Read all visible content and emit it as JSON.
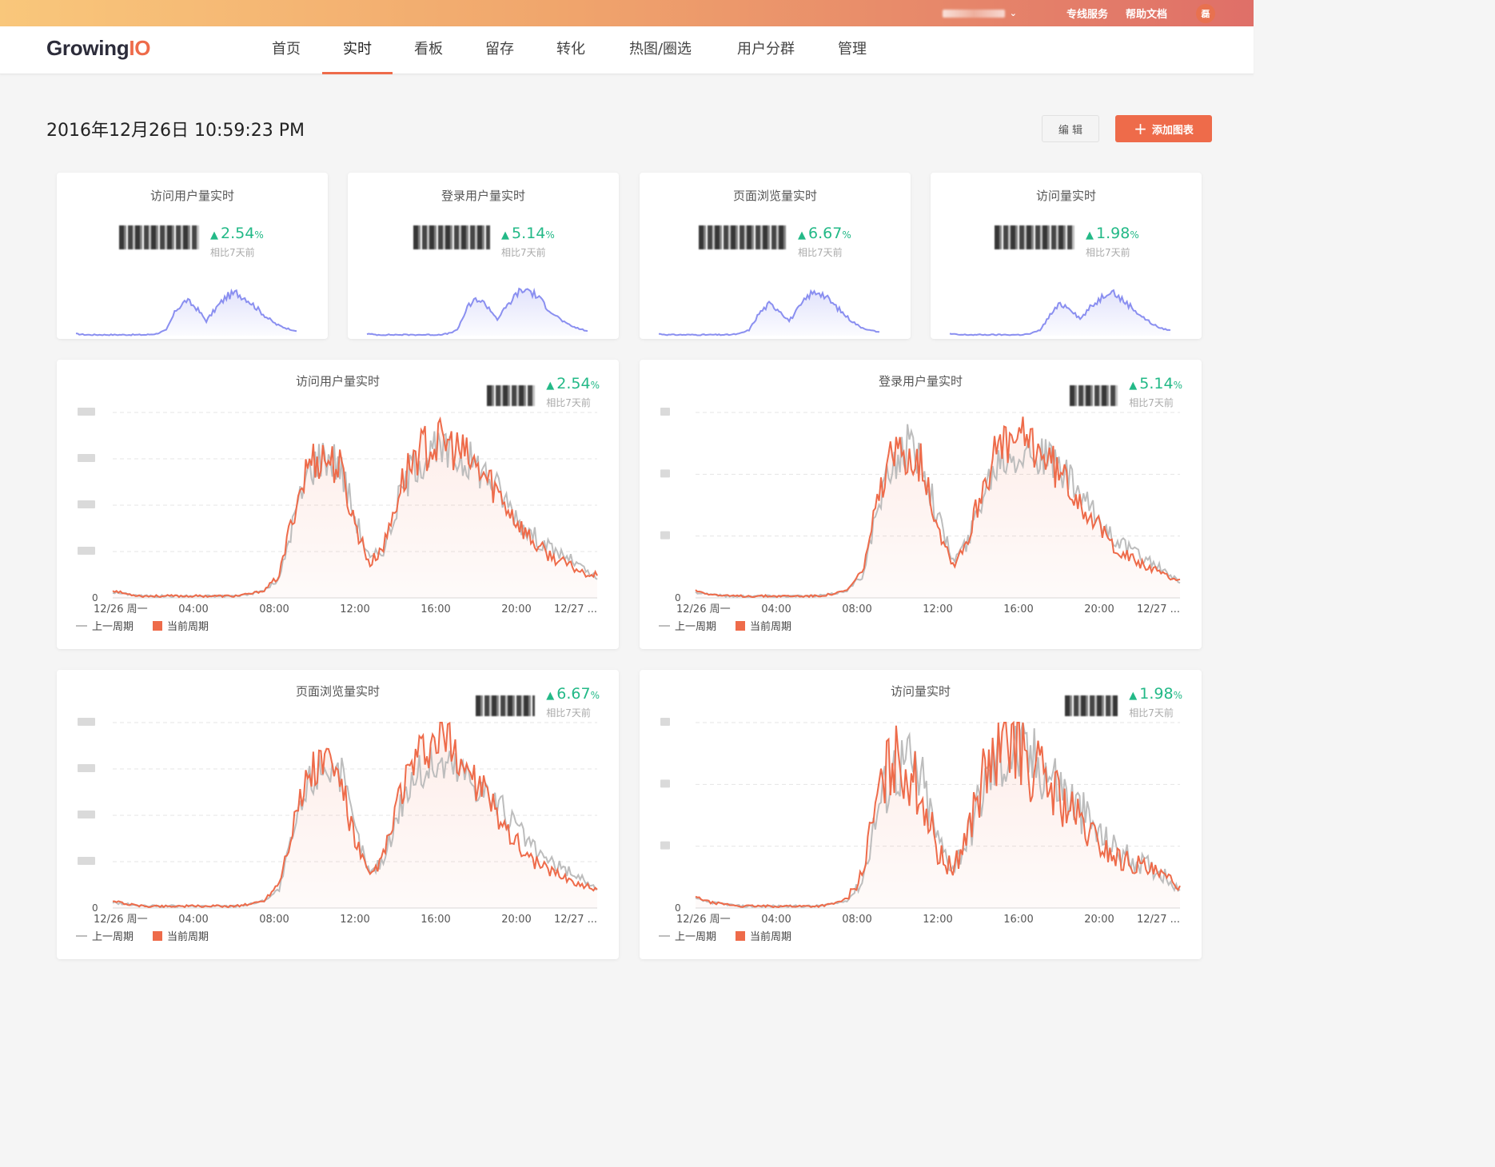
{
  "topbar": {
    "user_chevron": "⌄",
    "links": [
      "专线服务",
      "帮助文档"
    ],
    "avatar_text": "磊"
  },
  "nav": {
    "logo_main": "Growing",
    "logo_io": "IO",
    "tabs": [
      "首页",
      "实时",
      "看板",
      "留存",
      "转化",
      "热图/圈选",
      "用户分群",
      "管理"
    ],
    "active_tab": "实时"
  },
  "header": {
    "datetime": "2016年12月26日 10:59:23 PM",
    "edit_label": "编 辑",
    "add_label": "添加图表"
  },
  "kpis": [
    {
      "title": "访问用户量实时",
      "value": "",
      "delta": "2.54",
      "compare": "相比7天前"
    },
    {
      "title": "登录用户量实时",
      "value": "",
      "delta": "5.14",
      "compare": "相比7天前"
    },
    {
      "title": "页面浏览量实时",
      "value": "",
      "delta": "6.67",
      "compare": "相比7天前"
    },
    {
      "title": "访问量实时",
      "value": "",
      "delta": "1.98",
      "compare": "相比7天前"
    }
  ],
  "chart_cards": [
    {
      "title": "访问用户量实时",
      "delta": "2.54",
      "compare": "相比7天前"
    },
    {
      "title": "登录用户量实时",
      "delta": "5.14",
      "compare": "相比7天前"
    },
    {
      "title": "页面浏览量实时",
      "delta": "6.67",
      "compare": "相比7天前"
    },
    {
      "title": "访问量实时",
      "delta": "1.98",
      "compare": "相比7天前"
    }
  ],
  "legend": {
    "prev": "上一周期",
    "current": "当前周期"
  },
  "colors": {
    "accent": "#ee6b4a",
    "positive": "#23b987",
    "kpi_line": "#8a8ff0",
    "prev_line": "#bdbdbd"
  },
  "chart_data": [
    {
      "type": "area",
      "title": "访问用户量实时",
      "x": [
        "12/26 周一",
        "04:00",
        "08:00",
        "12:00",
        "16:00",
        "20:00",
        "12/27 ..."
      ],
      "y_tick_labels_masked": true,
      "series": [
        {
          "name": "当前周期",
          "values": [
            4,
            2,
            1,
            1,
            1,
            1,
            1,
            1,
            1,
            2,
            4,
            12,
            48,
            74,
            76,
            70,
            40,
            18,
            30,
            60,
            78,
            82,
            84,
            78,
            70,
            62,
            50,
            38,
            28,
            22,
            18,
            14,
            12
          ]
        },
        {
          "name": "上一周期",
          "values": [
            3,
            2,
            1,
            1,
            1,
            1,
            1,
            1,
            1,
            2,
            4,
            10,
            44,
            70,
            78,
            72,
            44,
            20,
            28,
            56,
            74,
            78,
            78,
            76,
            72,
            64,
            52,
            40,
            32,
            26,
            22,
            16,
            10
          ]
        }
      ]
    },
    {
      "type": "area",
      "title": "登录用户量实时",
      "x": [
        "12/26 周一",
        "04:00",
        "08:00",
        "12:00",
        "16:00",
        "20:00",
        "12/27 ..."
      ],
      "y_tick_labels_masked": true,
      "series": [
        {
          "name": "当前周期",
          "values": [
            4,
            2,
            1,
            1,
            1,
            1,
            1,
            1,
            1,
            2,
            4,
            14,
            50,
            76,
            80,
            72,
            40,
            18,
            32,
            62,
            80,
            84,
            86,
            78,
            68,
            58,
            46,
            34,
            26,
            20,
            16,
            12,
            10
          ]
        },
        {
          "name": "上一周期",
          "values": [
            3,
            2,
            1,
            1,
            1,
            1,
            1,
            1,
            1,
            2,
            4,
            12,
            46,
            72,
            82,
            74,
            44,
            20,
            30,
            58,
            76,
            80,
            80,
            76,
            70,
            60,
            48,
            38,
            30,
            24,
            20,
            14,
            8
          ]
        }
      ]
    },
    {
      "type": "area",
      "title": "页面浏览量实时",
      "x": [
        "12/26 周一",
        "04:00",
        "08:00",
        "12:00",
        "16:00",
        "20:00",
        "12/27 ..."
      ],
      "y_tick_labels_masked": true,
      "series": [
        {
          "name": "当前周期",
          "values": [
            4,
            2,
            1,
            1,
            1,
            1,
            1,
            1,
            1,
            2,
            4,
            14,
            48,
            72,
            80,
            70,
            36,
            16,
            30,
            62,
            78,
            86,
            90,
            80,
            68,
            56,
            44,
            32,
            24,
            20,
            16,
            12,
            10
          ]
        },
        {
          "name": "上一周期",
          "values": [
            3,
            2,
            1,
            1,
            1,
            1,
            1,
            1,
            1,
            2,
            4,
            10,
            42,
            68,
            78,
            74,
            42,
            18,
            28,
            56,
            72,
            76,
            78,
            74,
            68,
            60,
            50,
            40,
            30,
            24,
            20,
            16,
            10
          ]
        }
      ]
    },
    {
      "type": "area",
      "title": "访问量实时",
      "x": [
        "12/26 周一",
        "04:00",
        "08:00",
        "12:00",
        "16:00",
        "20:00",
        "12/27 ..."
      ],
      "y_tick_labels_masked": true,
      "series": [
        {
          "name": "当前周期",
          "values": [
            6,
            3,
            2,
            1,
            1,
            1,
            1,
            1,
            1,
            2,
            5,
            18,
            58,
            80,
            76,
            60,
            30,
            20,
            42,
            70,
            82,
            94,
            78,
            70,
            60,
            50,
            40,
            32,
            26,
            24,
            20,
            16,
            12
          ]
        },
        {
          "name": "上一周期",
          "values": [
            5,
            3,
            2,
            1,
            1,
            1,
            1,
            1,
            1,
            2,
            4,
            14,
            52,
            74,
            78,
            66,
            36,
            22,
            38,
            64,
            80,
            84,
            80,
            76,
            66,
            56,
            46,
            36,
            30,
            26,
            22,
            18,
            10
          ]
        }
      ]
    }
  ],
  "kpi_sparklines": [
    [
      2,
      1,
      1,
      1,
      1,
      1,
      1,
      1,
      2,
      6,
      28,
      38,
      30,
      16,
      30,
      42,
      46,
      40,
      30,
      20,
      12,
      8,
      5
    ],
    [
      2,
      1,
      1,
      1,
      1,
      1,
      1,
      1,
      2,
      6,
      30,
      40,
      32,
      18,
      32,
      46,
      50,
      42,
      30,
      20,
      12,
      8,
      5
    ],
    [
      2,
      1,
      1,
      1,
      1,
      1,
      1,
      1,
      2,
      6,
      24,
      34,
      28,
      16,
      30,
      44,
      48,
      38,
      28,
      18,
      10,
      6,
      4
    ],
    [
      2,
      1,
      1,
      1,
      1,
      1,
      1,
      1,
      2,
      6,
      22,
      34,
      30,
      18,
      30,
      40,
      50,
      40,
      32,
      22,
      14,
      8,
      6
    ]
  ]
}
